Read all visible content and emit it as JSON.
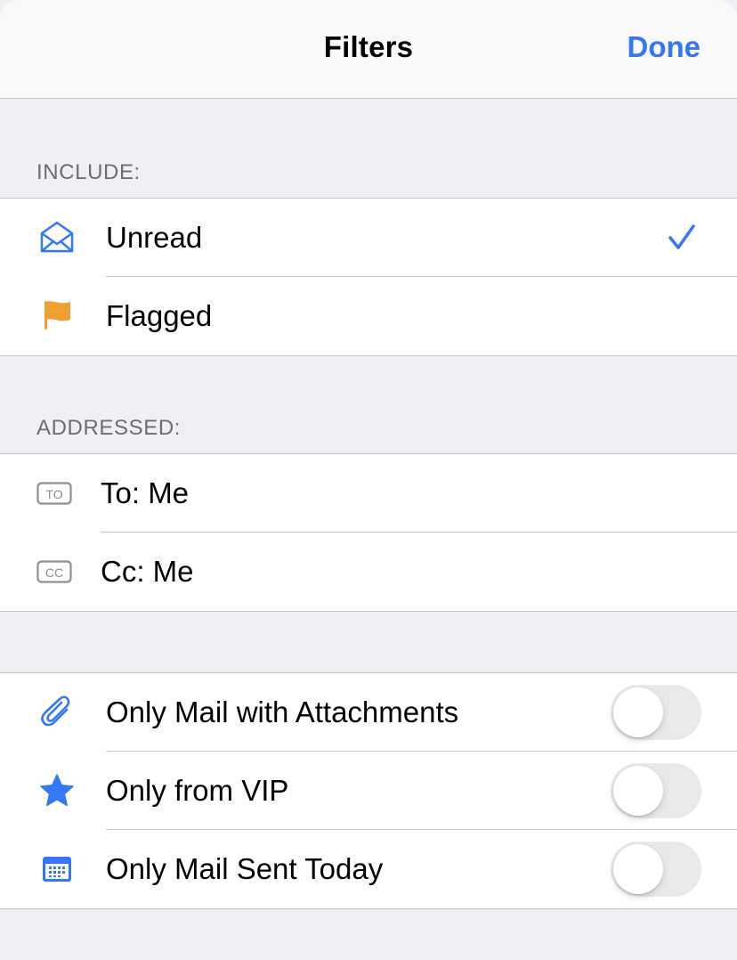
{
  "navbar": {
    "title": "Filters",
    "done_label": "Done"
  },
  "include": {
    "header": "INCLUDE:",
    "items": [
      {
        "label": "Unread",
        "icon": "envelope-open-icon",
        "checked": true
      },
      {
        "label": "Flagged",
        "icon": "flag-icon",
        "checked": false
      }
    ]
  },
  "addressed": {
    "header": "ADDRESSED:",
    "items": [
      {
        "label": "To: Me",
        "icon": "to-badge-icon",
        "badge": "TO"
      },
      {
        "label": "Cc: Me",
        "icon": "cc-badge-icon",
        "badge": "CC"
      }
    ]
  },
  "options": {
    "items": [
      {
        "label": "Only Mail with Attachments",
        "icon": "paperclip-icon",
        "on": false
      },
      {
        "label": "Only from VIP",
        "icon": "star-icon",
        "on": false
      },
      {
        "label": "Only Mail Sent Today",
        "icon": "calendar-icon",
        "on": false
      }
    ]
  },
  "colors": {
    "accent": "#3478f6",
    "flag": "#f0a030",
    "separator": "#c6c6c8",
    "grouped_background": "#efeff4",
    "toggle_off": "#e9e9ea"
  }
}
